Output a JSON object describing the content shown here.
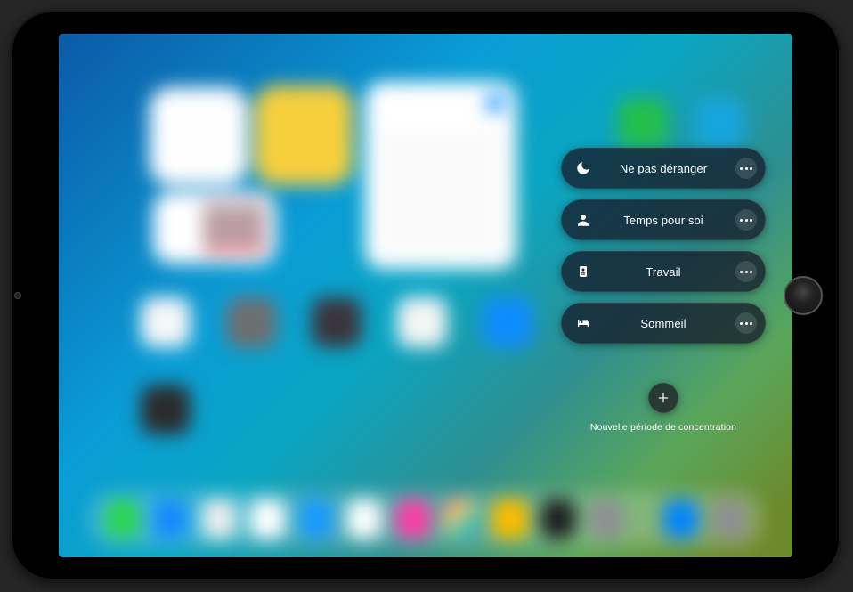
{
  "focus": {
    "items": [
      {
        "label": "Ne pas déranger",
        "icon": "moon"
      },
      {
        "label": "Temps pour soi",
        "icon": "person"
      },
      {
        "label": "Travail",
        "icon": "badge"
      },
      {
        "label": "Sommeil",
        "icon": "bed"
      }
    ],
    "add_label": "Nouvelle période de concentration"
  }
}
